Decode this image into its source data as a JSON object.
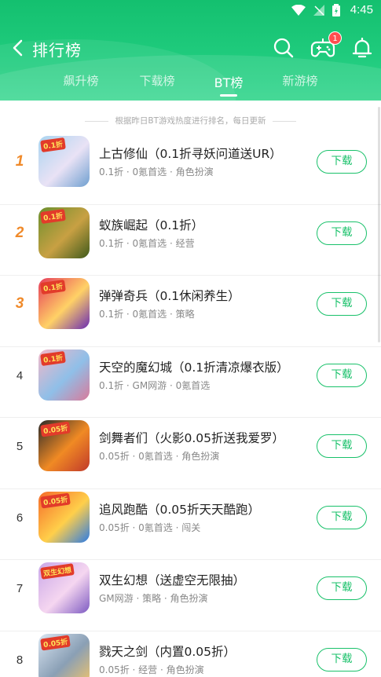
{
  "status_bar": {
    "time": "4:45"
  },
  "header": {
    "title": "排行榜",
    "game_badge_count": "1",
    "tabs": [
      {
        "label": "飙升榜",
        "active": false
      },
      {
        "label": "下载榜",
        "active": false
      },
      {
        "label": "BT榜",
        "active": true
      },
      {
        "label": "新游榜",
        "active": false
      }
    ]
  },
  "notice": "根据昨日BT游戏热度进行排名，每日更新",
  "download_label": "下载",
  "apps": [
    {
      "rank": "1",
      "name": "上古修仙（0.1折寻妖问道送UR）",
      "meta": "0.1折 · 0氪首选 · 角色扮演",
      "icon_tag": "0.1折",
      "colors": [
        "#a9d4f0",
        "#e9e2f5",
        "#6f9fd0"
      ]
    },
    {
      "rank": "2",
      "name": "蚁族崛起（0.1折）",
      "meta": "0.1折 · 0氪首选 · 经营",
      "icon_tag": "0.1折",
      "colors": [
        "#6b8f2d",
        "#c8a043",
        "#3f5a1b"
      ]
    },
    {
      "rank": "3",
      "name": "弹弹奇兵（0.1休闲养生）",
      "meta": "0.1折 · 0氪首选 · 策略",
      "icon_tag": "0.1折",
      "colors": [
        "#e63c5b",
        "#ffd166",
        "#6a2bb3"
      ]
    },
    {
      "rank": "4",
      "name": "天空的魔幻城（0.1折清凉爆衣版）",
      "meta": "0.1折 · GM网游 · 0氪首选",
      "icon_tag": "0.1折",
      "colors": [
        "#f4b8c8",
        "#8fbfe8",
        "#d97a9a"
      ]
    },
    {
      "rank": "5",
      "name": "剑舞者们（火影0.05折送我爱罗）",
      "meta": "0.05折 · 0氪首选 · 角色扮演",
      "icon_tag": "0.05折",
      "colors": [
        "#2a2a2a",
        "#f08a24",
        "#c0392b"
      ]
    },
    {
      "rank": "6",
      "name": "追风跑酷（0.05折天天酷跑）",
      "meta": "0.05折 · 0氪首选 · 闯关",
      "icon_tag": "0.05折",
      "colors": [
        "#f56b2a",
        "#ffcf4a",
        "#2c7be5"
      ]
    },
    {
      "rank": "7",
      "name": "双生幻想（送虚空无限抽）",
      "meta": "GM网游 · 策略 · 角色扮演",
      "icon_tag": "双生幻想",
      "colors": [
        "#c9a7e8",
        "#f5d6f0",
        "#7e5bc2"
      ]
    },
    {
      "rank": "8",
      "name": "戮天之剑（内置0.05折）",
      "meta": "0.05折 · 经营 · 角色扮演",
      "icon_tag": "0.05折",
      "colors": [
        "#d9e6f2",
        "#8a9fb5",
        "#f0c46b"
      ]
    }
  ],
  "accent_color": "#19c16a",
  "rank_highlight_color": "#f08a2a"
}
